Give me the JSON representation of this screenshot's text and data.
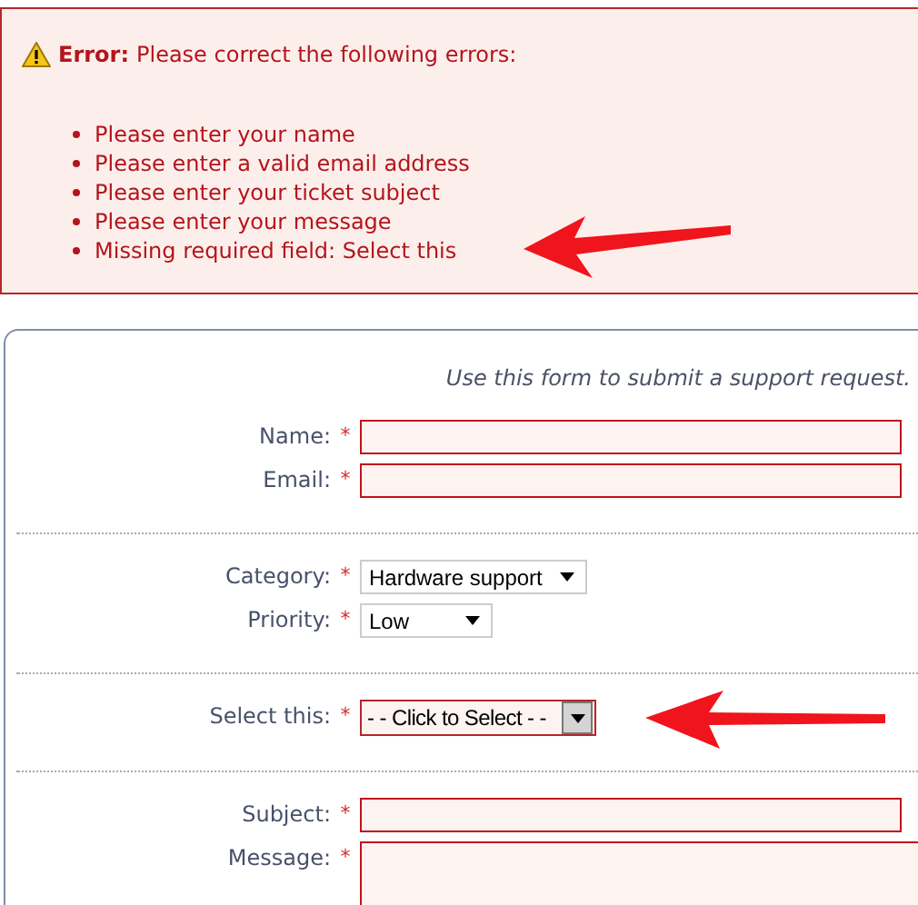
{
  "error_box": {
    "title": "Error:",
    "message": "Please correct the following errors:",
    "items": [
      "Please enter your name",
      "Please enter a valid email address",
      "Please enter your ticket subject",
      "Please enter your message",
      "Missing required field: Select this"
    ]
  },
  "form": {
    "intro": "Use this form to submit a support request.",
    "sections": [
      {
        "fields": [
          {
            "label": "Name:",
            "marker": "*",
            "kind": "text",
            "error": true
          },
          {
            "label": "Email:",
            "marker": "*",
            "kind": "text",
            "error": true
          }
        ]
      },
      {
        "fields": [
          {
            "label": "Category:",
            "marker": "*",
            "kind": "select",
            "value": "Hardware support",
            "error": false
          },
          {
            "label": "Priority:",
            "marker": "*",
            "kind": "select",
            "value": "Low",
            "error": false
          }
        ]
      },
      {
        "fields": [
          {
            "label": "Select this:",
            "marker": "*",
            "kind": "combo",
            "value": "- - Click to Select - -",
            "error": true
          }
        ]
      },
      {
        "fields": [
          {
            "label": "Subject:",
            "marker": "*",
            "kind": "text",
            "error": true
          },
          {
            "label": "Message:",
            "marker": "*",
            "kind": "textarea",
            "error": true
          }
        ]
      }
    ]
  }
}
